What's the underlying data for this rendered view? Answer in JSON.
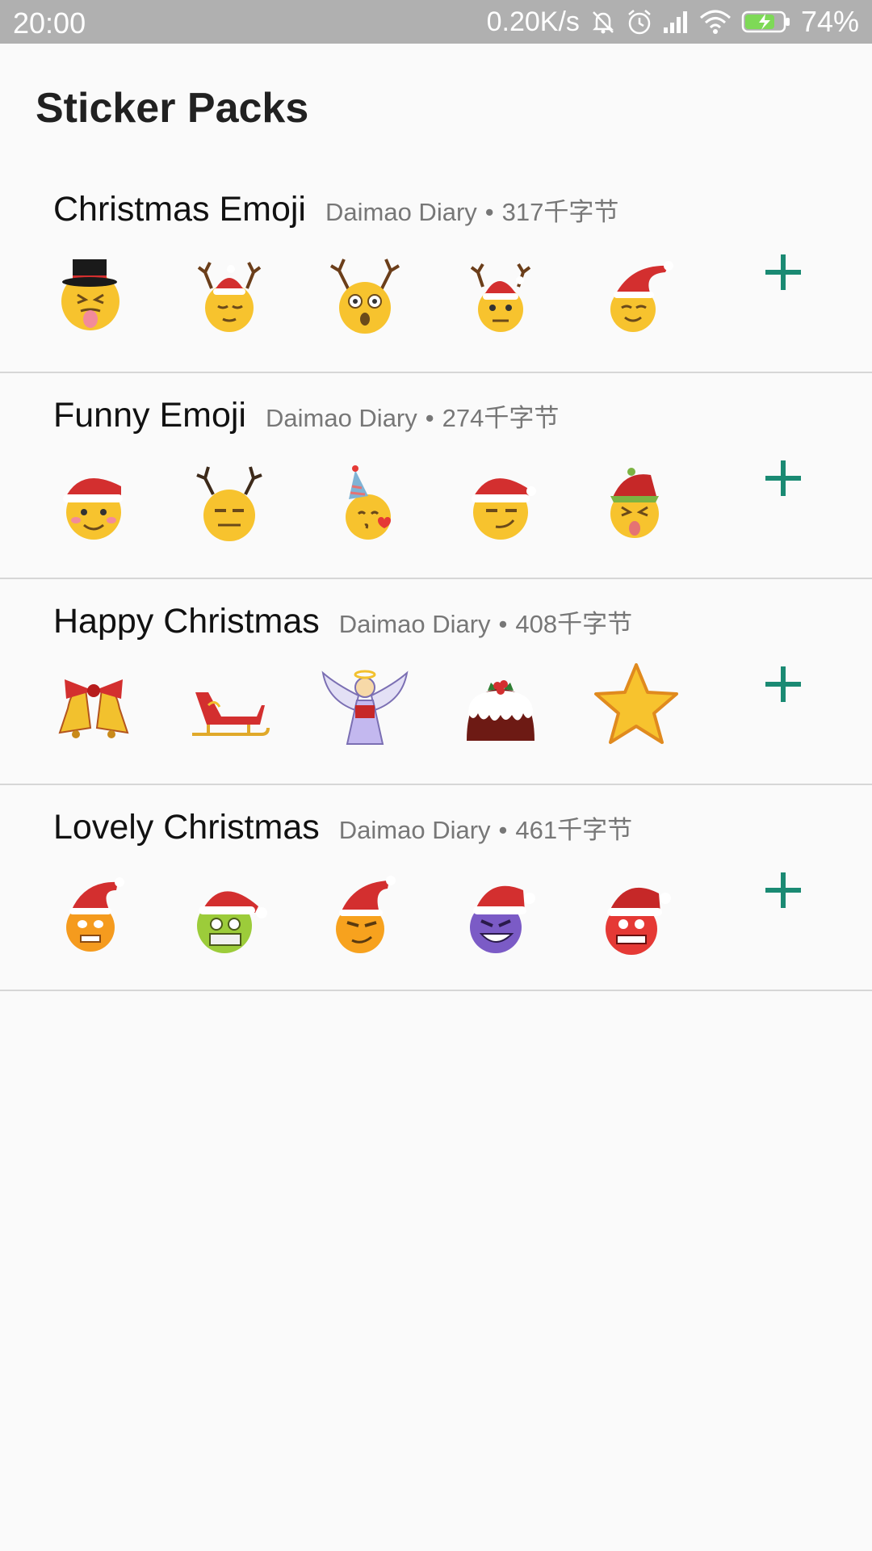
{
  "status_bar": {
    "time": "20:00",
    "net_speed": "0.20K/s",
    "battery": "74%"
  },
  "header": {
    "title": "Sticker Packs"
  },
  "packs": [
    {
      "name": "Christmas Emoji",
      "author": "Daimao Diary",
      "separator": "•",
      "size": "317千字节",
      "stickers": [
        "tongue-top-hat-emoji",
        "sleepy-reindeer-santa-emoji",
        "surprised-reindeer-emoji",
        "neutral-reindeer-santa-emoji",
        "smiling-santa-hat-emoji"
      ]
    },
    {
      "name": "Funny Emoji",
      "author": "Daimao Diary",
      "separator": "•",
      "size": "274千字节",
      "stickers": [
        "blushing-santa-hat-emoji",
        "expressionless-antlers-emoji",
        "kissing-party-hat-emoji",
        "smirking-santa-hat-emoji",
        "squinting-elf-hat-emoji"
      ]
    },
    {
      "name": "Happy Christmas",
      "author": "Daimao Diary",
      "separator": "•",
      "size": "408千字节",
      "stickers": [
        "christmas-bells",
        "santa-sleigh",
        "angel-with-book",
        "christmas-pudding",
        "gold-star"
      ]
    },
    {
      "name": "Lovely Christmas",
      "author": "Daimao Diary",
      "separator": "•",
      "size": "461千字节",
      "stickers": [
        "orange-grin-santa-emoji",
        "green-masked-santa-emoji",
        "sly-santa-emoji",
        "purple-devil-santa-emoji",
        "red-angry-santa-emoji"
      ]
    }
  ],
  "colors": {
    "accent": "#1a8a73",
    "status_bar": "#b0b0b0",
    "background": "#fafafa"
  }
}
